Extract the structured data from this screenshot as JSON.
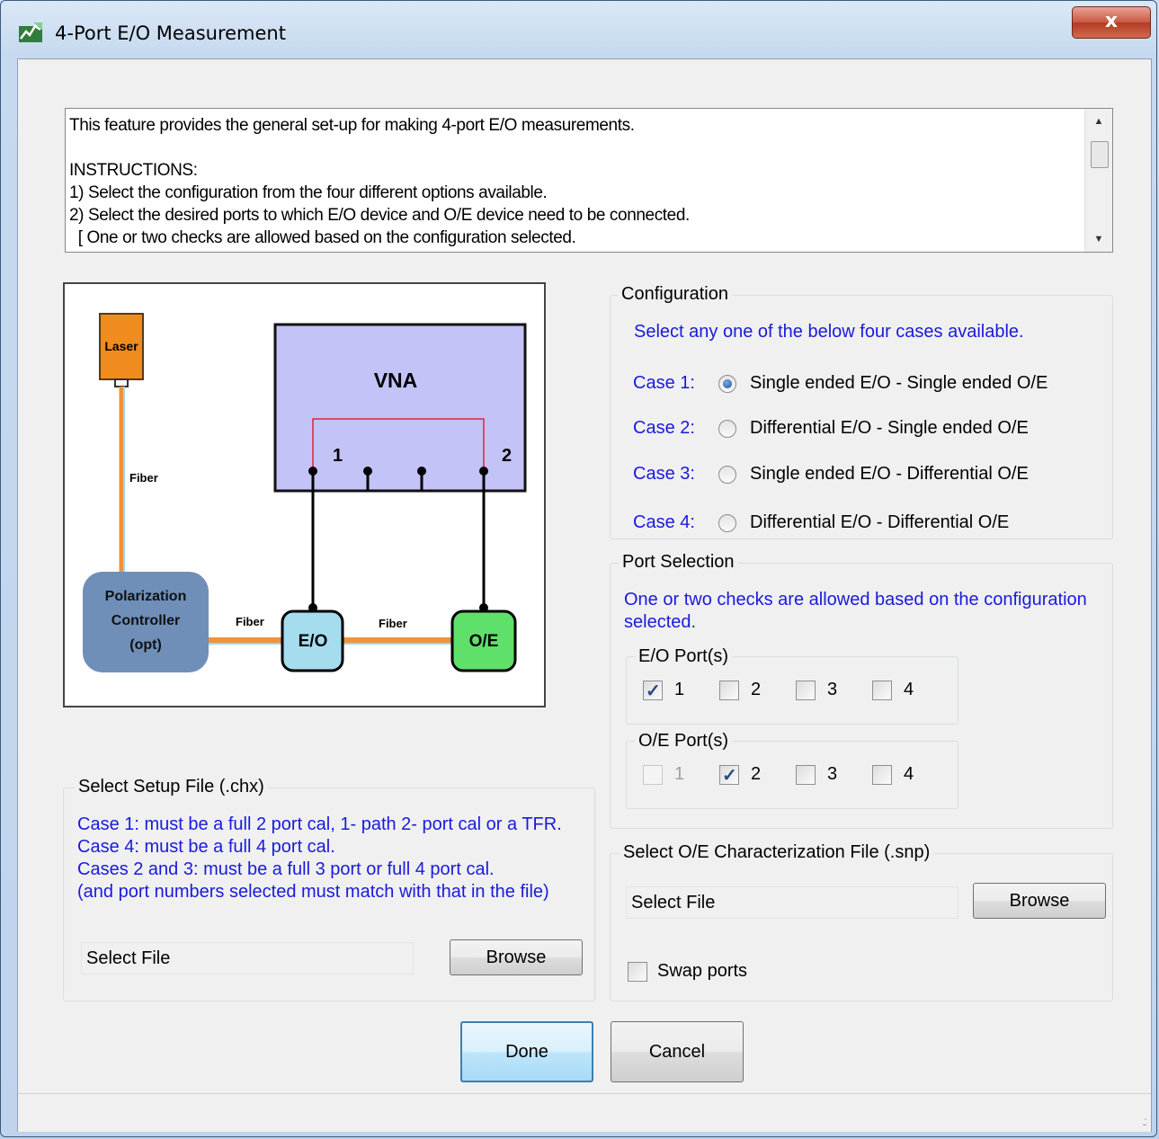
{
  "window": {
    "title": "4-Port E/O Measurement",
    "close_label": "x"
  },
  "info": {
    "lines": [
      "This feature provides the general set-up for making 4-port E/O measurements.",
      "",
      "INSTRUCTIONS:",
      "1) Select the configuration from the four different options available.",
      "2) Select the desired ports to which E/O device and O/E device need to be connected.",
      "  [ One or two checks are allowed based on the configuration selected."
    ]
  },
  "diagram": {
    "laser": "Laser",
    "fiber_vertical": "Fiber",
    "vna": "VNA",
    "port1": "1",
    "port2": "2",
    "polarization": [
      "Polarization",
      "Controller",
      "(opt)"
    ],
    "fiber_left": "Fiber",
    "fiber_right": "Fiber",
    "eo": "E/O",
    "oe": "O/E",
    "colors": {
      "laser": "#f08b1e",
      "vna": "#c3c3f7",
      "pol": "#6f8fb8",
      "eo": "#a6ddee",
      "oe": "#5fe06a",
      "fiber": "#f0933a"
    }
  },
  "configuration": {
    "title": "Configuration",
    "hint": "Select any one of the below four cases available.",
    "cases": [
      {
        "label": "Case 1:",
        "text": "Single ended E/O - Single ended O/E",
        "selected": true
      },
      {
        "label": "Case 2:",
        "text": "Differential E/O - Single ended O/E",
        "selected": false
      },
      {
        "label": "Case 3:",
        "text": "Single ended E/O - Differential O/E",
        "selected": false
      },
      {
        "label": "Case 4:",
        "text": "Differential E/O - Differential O/E",
        "selected": false
      }
    ]
  },
  "port_selection": {
    "title": "Port Selection",
    "hint_line1": "One or two checks are allowed based on the configuration",
    "hint_line2": "selected.",
    "eo_title": "E/O Port(s)",
    "eo_ports": [
      {
        "label": "1",
        "checked": true,
        "enabled": true
      },
      {
        "label": "2",
        "checked": false,
        "enabled": true
      },
      {
        "label": "3",
        "checked": false,
        "enabled": true
      },
      {
        "label": "4",
        "checked": false,
        "enabled": true
      }
    ],
    "oe_title": "O/E Port(s)",
    "oe_ports": [
      {
        "label": "1",
        "checked": false,
        "enabled": false
      },
      {
        "label": "2",
        "checked": true,
        "enabled": true
      },
      {
        "label": "3",
        "checked": false,
        "enabled": true
      },
      {
        "label": "4",
        "checked": false,
        "enabled": true
      }
    ]
  },
  "setup_file": {
    "title": "Select Setup File (.chx)",
    "notes": [
      "Case 1:  must be a full 2 port cal, 1- path 2- port cal or a TFR.",
      "Case 4:  must be a full 4 port cal.",
      "Cases 2 and 3:  must be a full 3 port or full 4 port cal.",
      " (and port numbers selected must match with that in the file)"
    ],
    "file_value": "Select File",
    "browse_label": "Browse"
  },
  "oe_file": {
    "title": "Select O/E Characterization File (.snp)",
    "file_value": "Select File",
    "browse_label": "Browse",
    "swap_label": "Swap ports",
    "swap_checked": false
  },
  "actions": {
    "done_label": "Done",
    "cancel_label": "Cancel"
  }
}
